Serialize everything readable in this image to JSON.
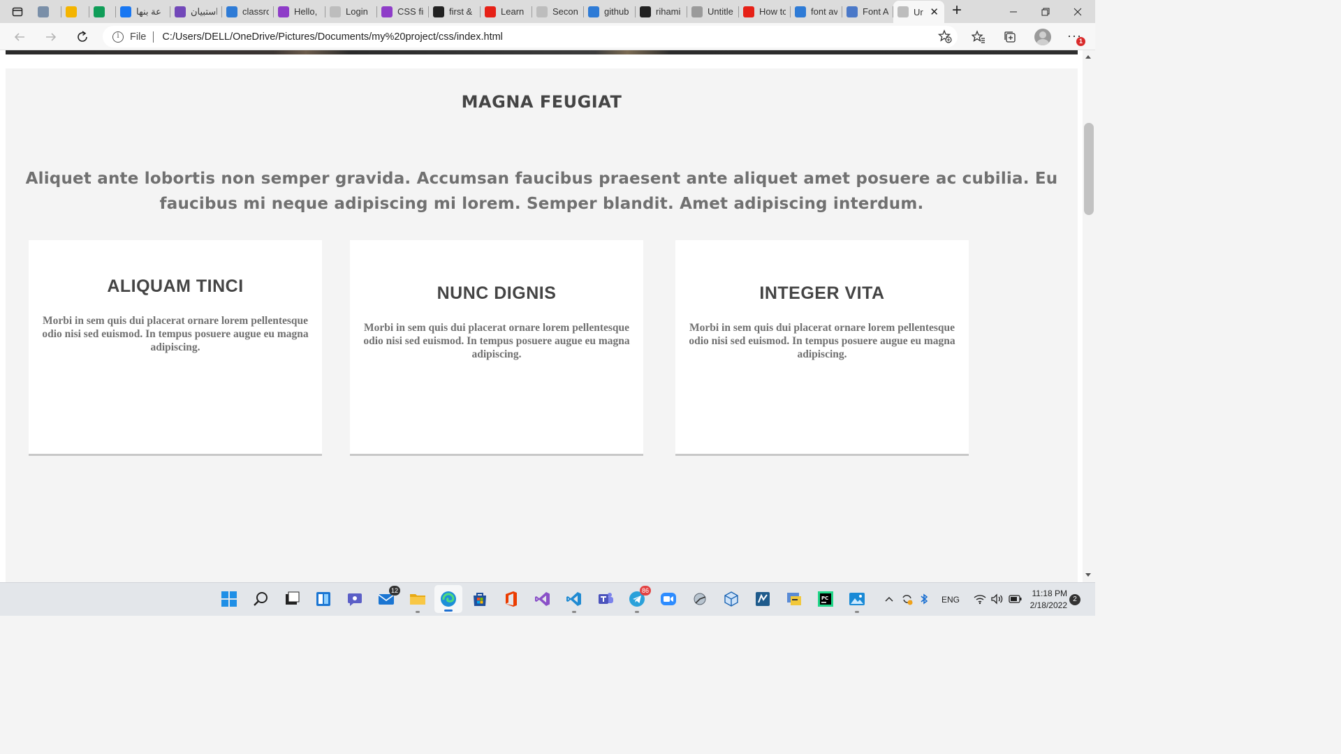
{
  "browser": {
    "tabs": [
      {
        "title": "",
        "favicon": "image-tab-icon",
        "color": "#7a8fa8"
      },
      {
        "title": "",
        "favicon": "google-drive-icon",
        "color": "#f4b400"
      },
      {
        "title": "",
        "favicon": "google-drive-icon",
        "color": "#0f9d58"
      },
      {
        "title": "عة بنها",
        "favicon": "facebook-icon",
        "color": "#1877f2"
      },
      {
        "title": "استبيان",
        "favicon": "forms-icon",
        "color": "#7248b9"
      },
      {
        "title": "classro",
        "favicon": "bing-icon",
        "color": "#2e7bd6"
      },
      {
        "title": "Hello, ",
        "favicon": "profile-icon",
        "color": "#8e3cc8"
      },
      {
        "title": "Login",
        "favicon": "document-icon",
        "color": "#bdbdbd"
      },
      {
        "title": "CSS fir",
        "favicon": "profile-icon",
        "color": "#8e3cc8"
      },
      {
        "title": "first &",
        "favicon": "github-icon",
        "color": "#222222"
      },
      {
        "title": "Learn ",
        "favicon": "youtube-icon",
        "color": "#e62117"
      },
      {
        "title": "Secon",
        "favicon": "document-icon",
        "color": "#bdbdbd"
      },
      {
        "title": "github",
        "favicon": "bing-icon",
        "color": "#2e7bd6"
      },
      {
        "title": "rihami",
        "favicon": "github-icon",
        "color": "#222222"
      },
      {
        "title": "Untitle",
        "favicon": "tab-icon",
        "color": "#9a9a9a"
      },
      {
        "title": "How tc",
        "favicon": "youtube-icon",
        "color": "#e62117"
      },
      {
        "title": "font av",
        "favicon": "bing-icon",
        "color": "#2e7bd6"
      },
      {
        "title": "Font A",
        "favicon": "flag-icon",
        "color": "#4a78c8"
      },
      {
        "title": "Ur",
        "favicon": "document-icon",
        "color": "#bdbdbd"
      }
    ],
    "address": {
      "scheme_label": "File",
      "url": "C:/Users/DELL/OneDrive/Pictures/Documents/my%20project/css/index.html"
    },
    "notification_count": "1"
  },
  "page": {
    "section_title": "MAGNA FEUGIAT",
    "section_lead": "Aliquet ante lobortis non semper gravida. Accumsan faucibus praesent ante aliquet amet posuere ac cubilia. Eu faucibus mi neque adipiscing mi lorem. Semper blandit. Amet adipiscing interdum.",
    "cards": [
      {
        "title": "ALIQUAM TINCI",
        "text": "Morbi in sem quis dui placerat ornare lorem pellentesque odio nisi sed euismod. In tempus posuere augue eu magna adipiscing."
      },
      {
        "title": "NUNC DIGNIS",
        "text": "Morbi in sem quis dui placerat ornare lorem pellentesque odio nisi sed euismod. In tempus posuere augue eu magna adipiscing."
      },
      {
        "title": "INTEGER VITA",
        "text": "Morbi in sem quis dui placerat ornare lorem pellentesque odio nisi sed euismod. In tempus posuere augue eu magna adipiscing."
      }
    ]
  },
  "taskbar": {
    "mail_badge": "12",
    "telegram_badge": "86",
    "language": "ENG",
    "time": "11:18 PM",
    "date": "2/18/2022",
    "notifications": "2"
  }
}
